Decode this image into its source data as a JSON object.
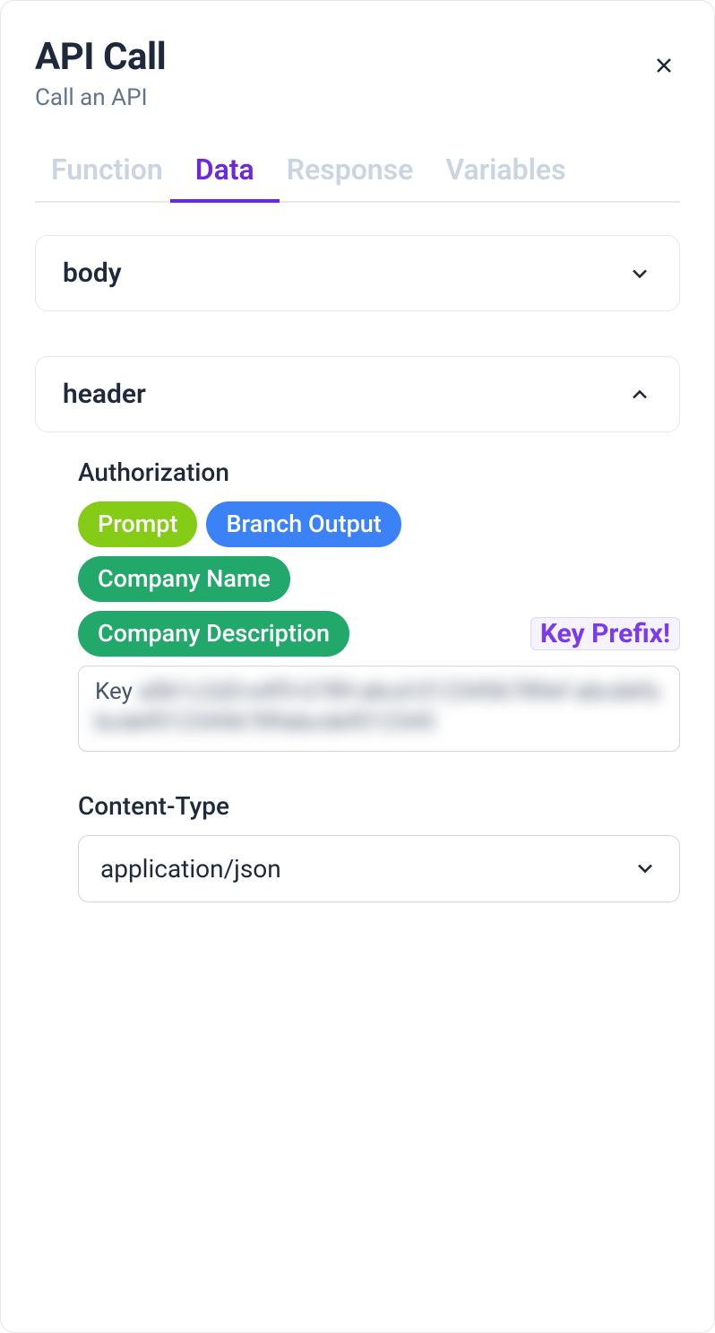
{
  "header": {
    "title": "API Call",
    "subtitle": "Call an API"
  },
  "tabs": {
    "items": [
      {
        "label": "Function",
        "active": false
      },
      {
        "label": "Data",
        "active": true
      },
      {
        "label": "Response",
        "active": false
      },
      {
        "label": "Variables",
        "active": false
      }
    ]
  },
  "body_section": {
    "title": "body",
    "expanded": false
  },
  "header_section": {
    "title": "header",
    "expanded": true,
    "authorization": {
      "label": "Authorization",
      "pills": [
        {
          "label": "Prompt",
          "color": "green-lime"
        },
        {
          "label": "Branch Output",
          "color": "blue"
        },
        {
          "label": "Company Name",
          "color": "green"
        },
        {
          "label": "Company Description",
          "color": "green"
        }
      ],
      "annotation": "Key Prefix!",
      "key_prefix": "Key",
      "key_value_redacted": "a0b1c2d3-e4f5-6789-abcd-0123456789ef abcdefabcdef0123456789abcdef012345"
    },
    "content_type": {
      "label": "Content-Type",
      "value": "application/json"
    }
  }
}
